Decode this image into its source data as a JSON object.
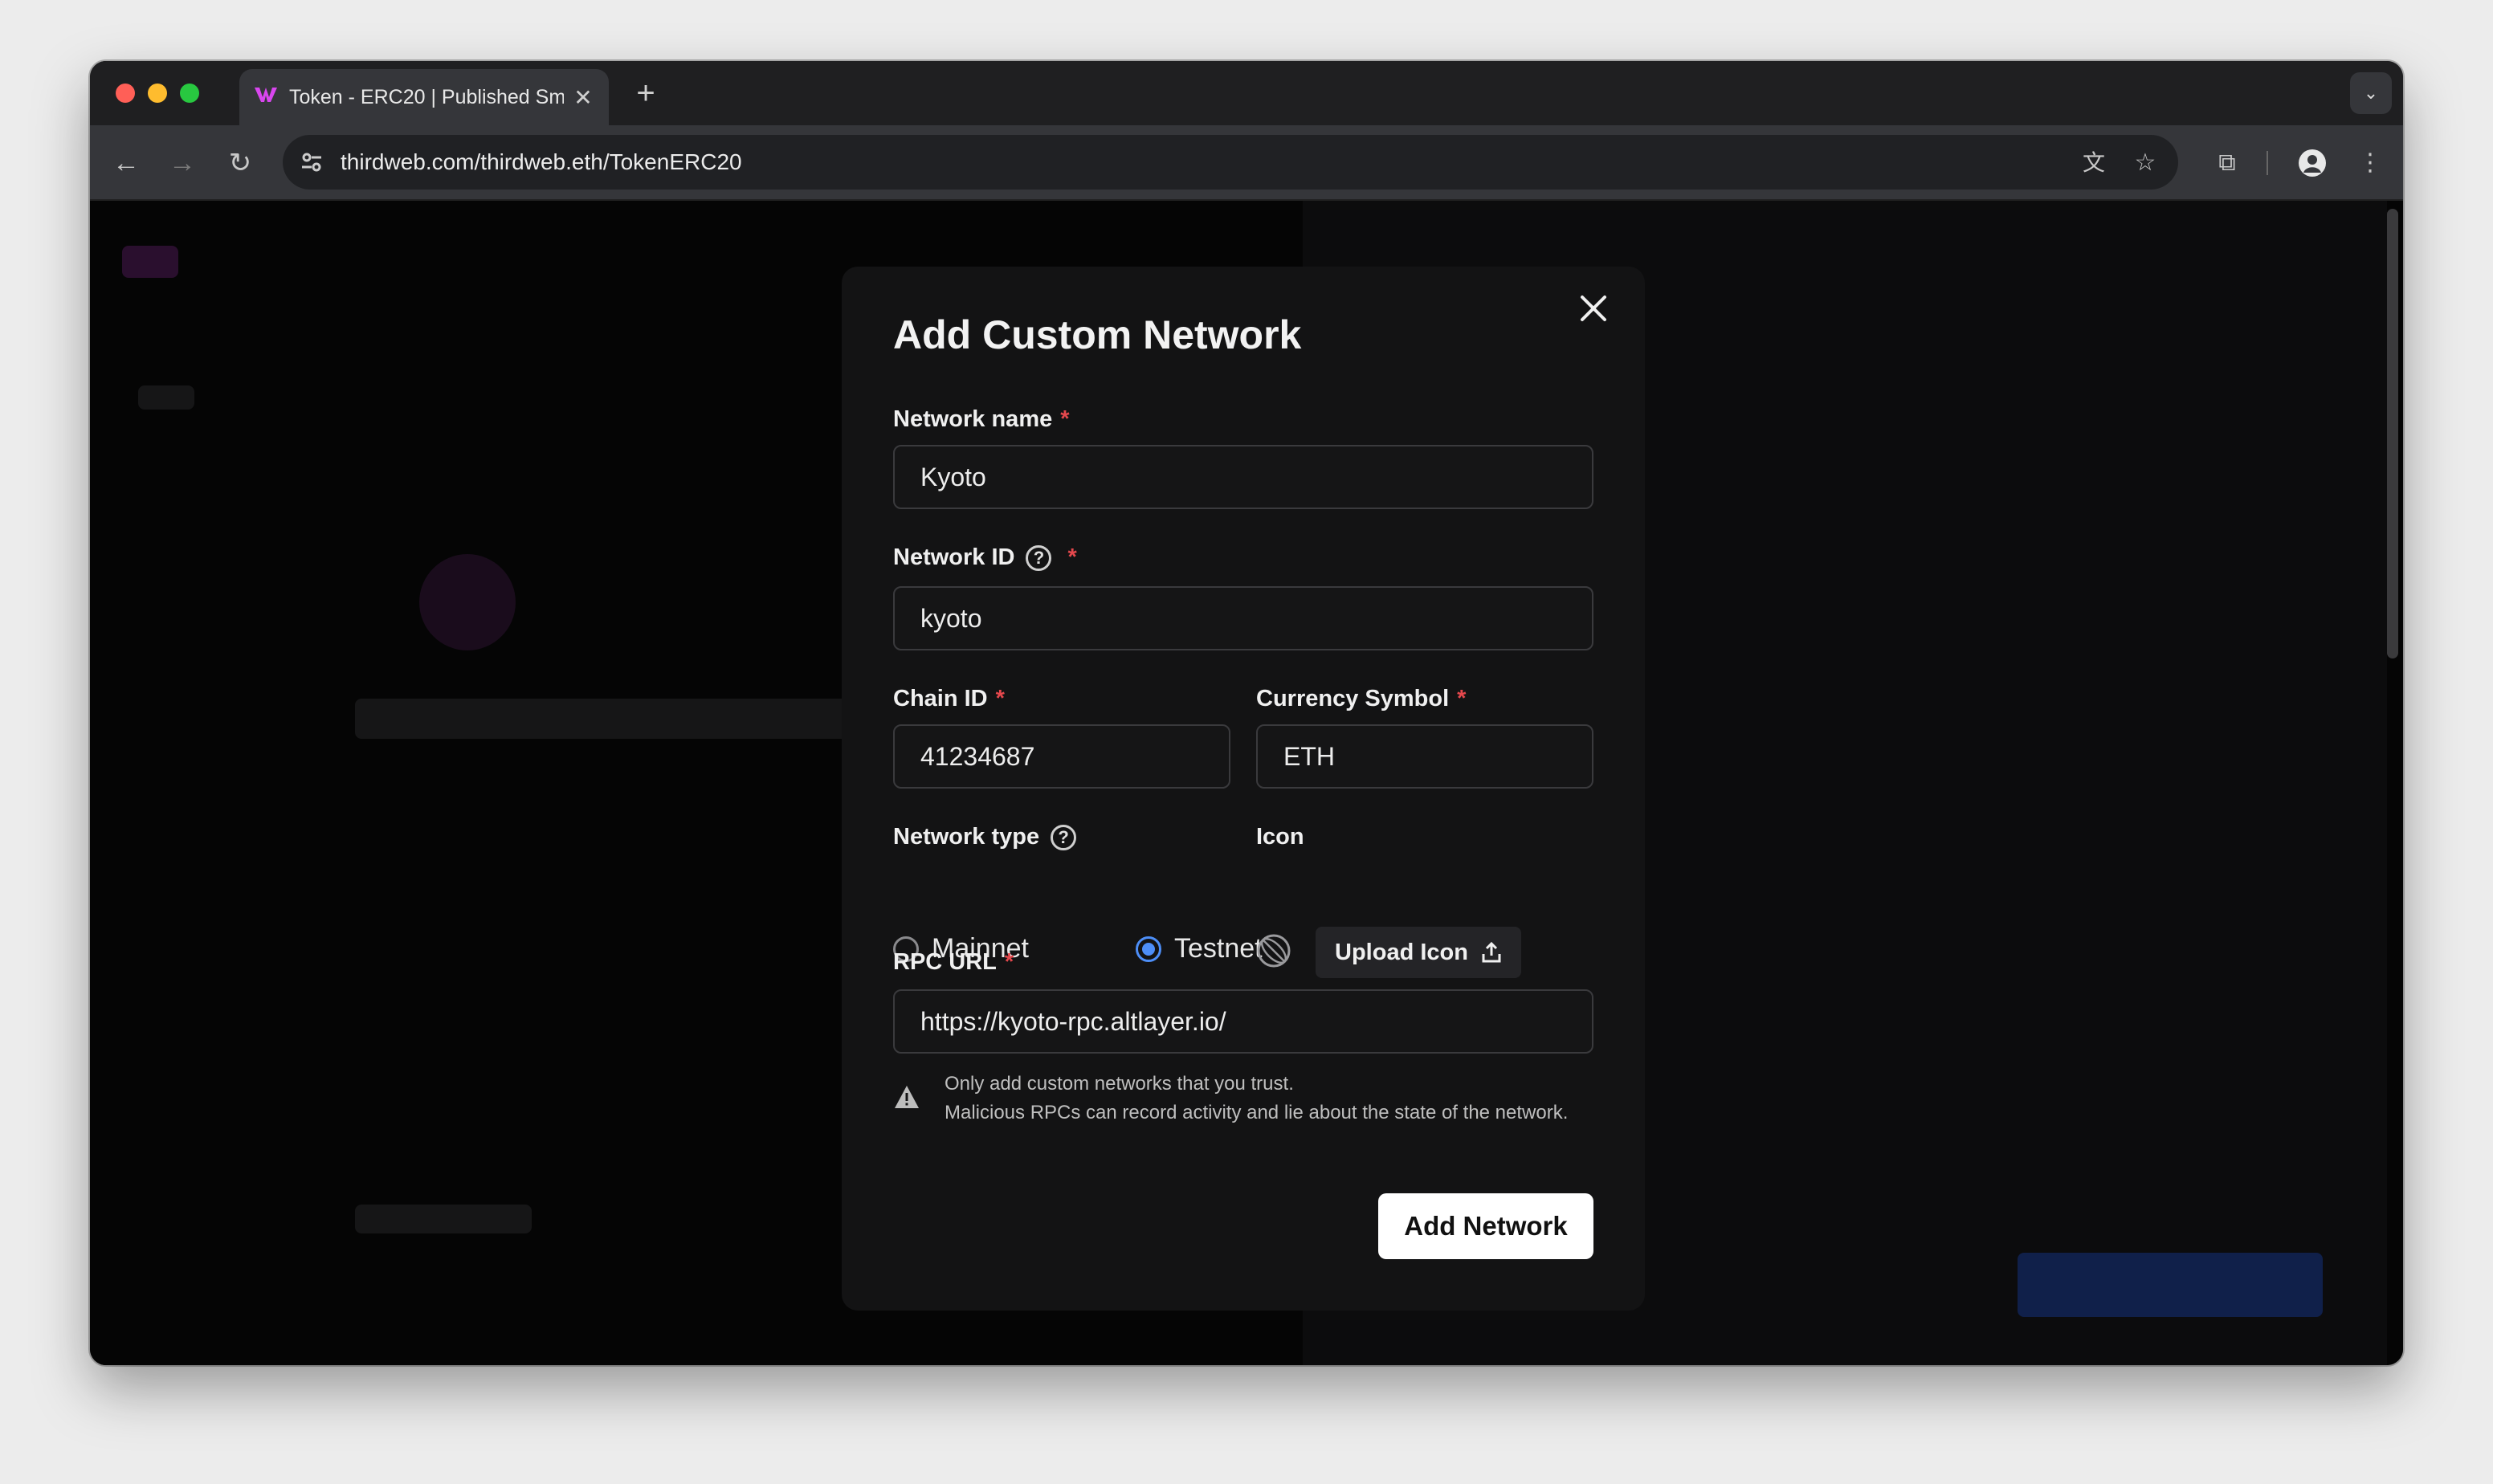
{
  "browser": {
    "tab_title": "Token - ERC20 | Published Sm",
    "new_tab_label": "+",
    "url": "thirdweb.com/thirdweb.eth/TokenERC20",
    "traffic_lights": [
      "#ff5f57",
      "#febc2e",
      "#28c840"
    ]
  },
  "modal": {
    "title": "Add Custom Network",
    "network_name": {
      "label": "Network name",
      "required": "*",
      "value": "Kyoto"
    },
    "network_id": {
      "label": "Network ID",
      "required": "*",
      "value": "kyoto"
    },
    "chain_id": {
      "label": "Chain ID",
      "required": "*",
      "value": "41234687"
    },
    "currency_symbol": {
      "label": "Currency Symbol",
      "required": "*",
      "value": "ETH"
    },
    "network_type": {
      "label": "Network type",
      "options": [
        {
          "label": "Mainnet",
          "selected": false
        },
        {
          "label": "Testnet",
          "selected": true
        }
      ]
    },
    "icon": {
      "label": "Icon",
      "upload_label": "Upload Icon"
    },
    "rpc_url": {
      "label": "RPC URL",
      "required": "*",
      "value": "https://kyoto-rpc.altlayer.io/"
    },
    "warning": {
      "line1": "Only add custom networks that you trust.",
      "line2": "Malicious RPCs can record activity and lie about the state of the network."
    },
    "submit_label": "Add Network"
  },
  "colors": {
    "accent": "#4d8ef7",
    "required": "#e5484d",
    "modal_bg": "#131314"
  }
}
